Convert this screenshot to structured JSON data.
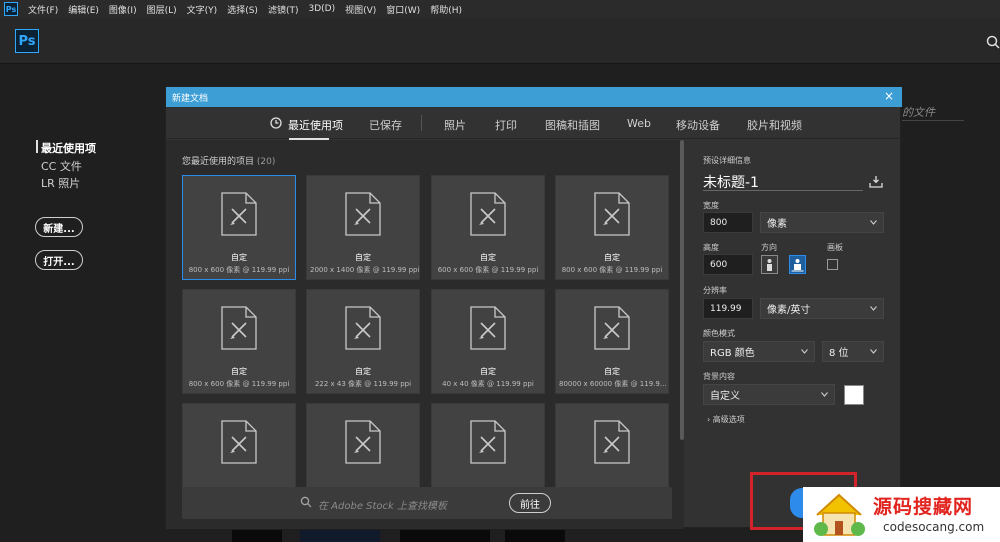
{
  "menubar": {
    "app_icon": "Ps",
    "items": [
      "文件(F)",
      "编辑(E)",
      "图像(I)",
      "图层(L)",
      "文字(Y)",
      "选择(S)",
      "滤镜(T)",
      "3D(D)",
      "视图(V)",
      "窗口(W)",
      "帮助(H)"
    ]
  },
  "home": {
    "logo": "Ps",
    "search_icon": "search-icon",
    "nav": [
      "最近使用项",
      "CC 文件",
      "LR 照片"
    ],
    "new_button": "新建...",
    "open_button": "打开...",
    "bg_partial_text": "的文件"
  },
  "dialog": {
    "title": "新建文档",
    "close": "×",
    "tabs": [
      "最近使用项",
      "已保存",
      "照片",
      "打印",
      "图稿和插图",
      "Web",
      "移动设备",
      "胶片和视频"
    ],
    "recent_label": "您最近使用的项目",
    "recent_count": "(20)",
    "presets": [
      {
        "name": "自定",
        "meta": "800 x 600 像素 @ 119.99 ppi"
      },
      {
        "name": "自定",
        "meta": "2000 x 1400 像素 @ 119.99 ppi"
      },
      {
        "name": "自定",
        "meta": "600 x 600 像素 @ 119.99 ppi"
      },
      {
        "name": "自定",
        "meta": "800 x 600 像素 @ 119.99 ppi"
      },
      {
        "name": "自定",
        "meta": "800 x 600 像素 @ 119.99 ppi"
      },
      {
        "name": "自定",
        "meta": "222 x 43 像素 @ 119.99 ppi"
      },
      {
        "name": "自定",
        "meta": "40 x 40 像素 @ 119.99 ppi"
      },
      {
        "name": "自定",
        "meta": "80000 x 60000 像素 @ 119.9..."
      },
      {
        "name": "",
        "meta": ""
      },
      {
        "name": "",
        "meta": ""
      },
      {
        "name": "",
        "meta": ""
      },
      {
        "name": "",
        "meta": ""
      }
    ],
    "stock_placeholder": "在 Adobe Stock 上查找模板",
    "go_button": "前往"
  },
  "details": {
    "header": "预设详细信息",
    "doc_title": "未标题-1",
    "width_label": "宽度",
    "width_value": "800",
    "width_unit": "像素",
    "height_label": "高度",
    "height_value": "600",
    "orientation_label": "方向",
    "artboard_label": "画板",
    "resolution_label": "分辨率",
    "resolution_value": "119.99",
    "resolution_unit": "像素/英寸",
    "color_mode_label": "颜色模式",
    "color_mode_value": "RGB 颜色",
    "bit_depth_value": "8 位",
    "background_label": "背景内容",
    "background_value": "自定义",
    "background_color": "#ffffff",
    "advanced_label": "高级选项"
  },
  "watermark": {
    "cn": "源码搜藏网",
    "url": "codesocang.com"
  },
  "colors": {
    "accent": "#3d9ed6",
    "selection": "#2d8ceb",
    "highlight_box": "#d2222a"
  }
}
